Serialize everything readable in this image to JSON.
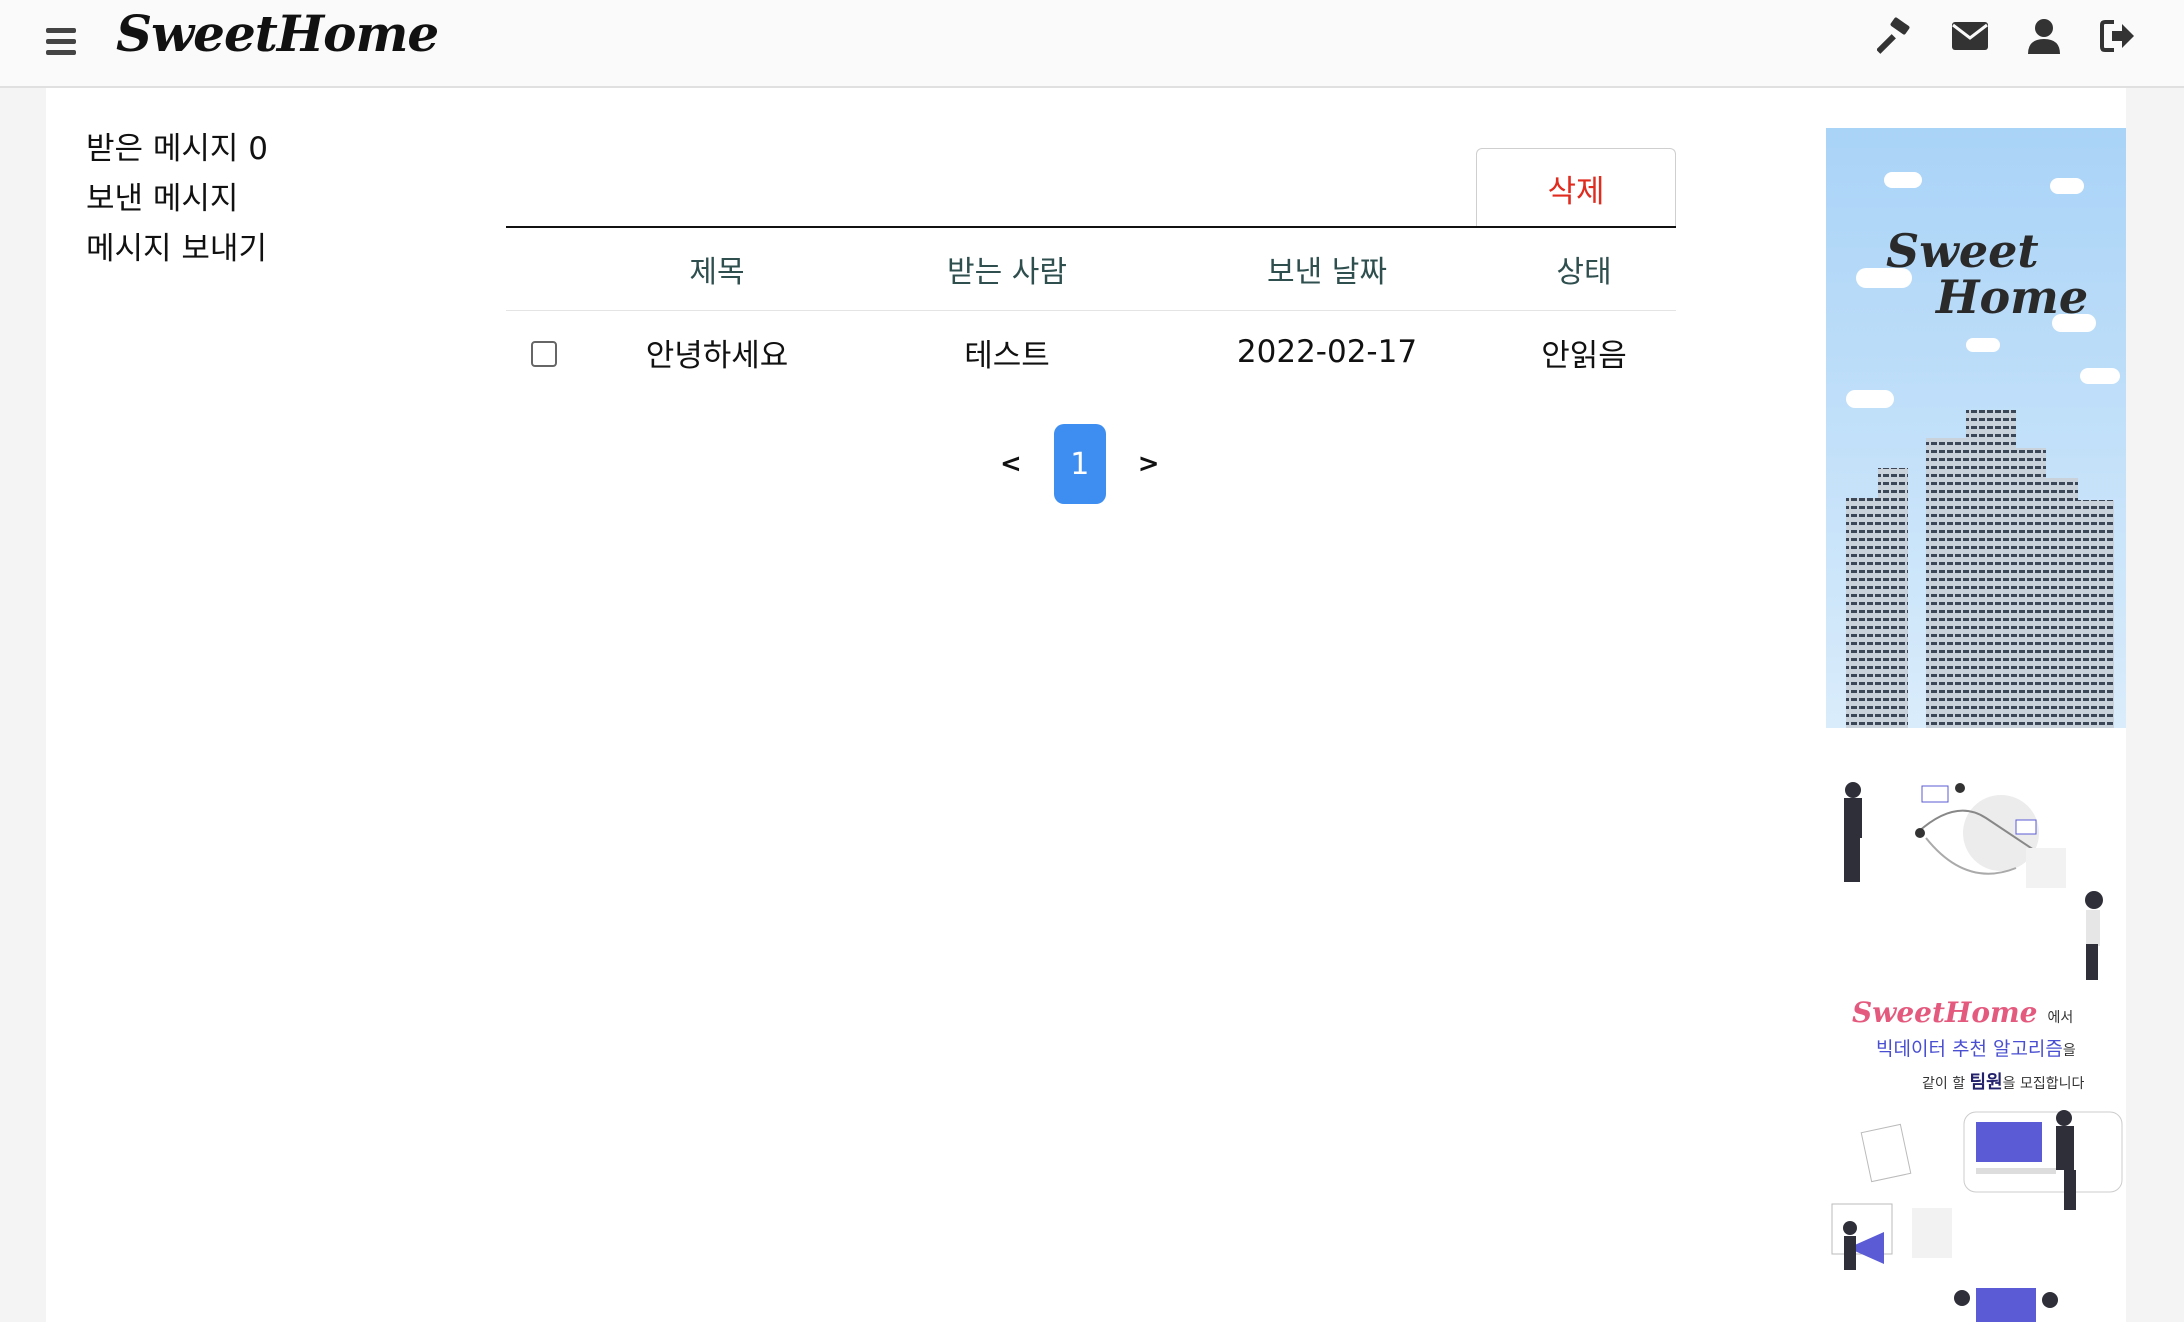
{
  "header": {
    "logo": "SweetHome",
    "icons": [
      "hamburger-menu-icon",
      "hammer-icon",
      "envelope-icon",
      "user-icon",
      "sign-out-icon"
    ]
  },
  "sidebar": {
    "items": [
      {
        "label": "받은 메시지 0"
      },
      {
        "label": "보낸 메시지"
      },
      {
        "label": "메시지 보내기"
      }
    ]
  },
  "toolbar": {
    "delete_label": "삭제"
  },
  "table": {
    "columns": [
      "제목",
      "받는 사람",
      "보낸 날짜",
      "상태"
    ],
    "rows": [
      {
        "checked": false,
        "title": "안녕하세요",
        "recipient": "테스트",
        "date": "2022-02-17",
        "status": "안읽음"
      }
    ]
  },
  "pagination": {
    "prev": "<",
    "current": "1",
    "next": ">"
  },
  "ads": {
    "banner1": {
      "line1": "Sweet",
      "line2": "Home"
    },
    "banner2": {
      "brand": "SweetHome",
      "brand_suffix": "에서",
      "line2_main": "빅데이터 추천 알고리즘",
      "line2_suffix": "을",
      "line3_prefix": "같이 할",
      "line3_bold": "팀원",
      "line3_suffix": "을 모집합니다"
    }
  },
  "colors": {
    "accent": "#3d8ef0",
    "delete": "#e02b1f",
    "header_text": "#2f4f4f"
  }
}
